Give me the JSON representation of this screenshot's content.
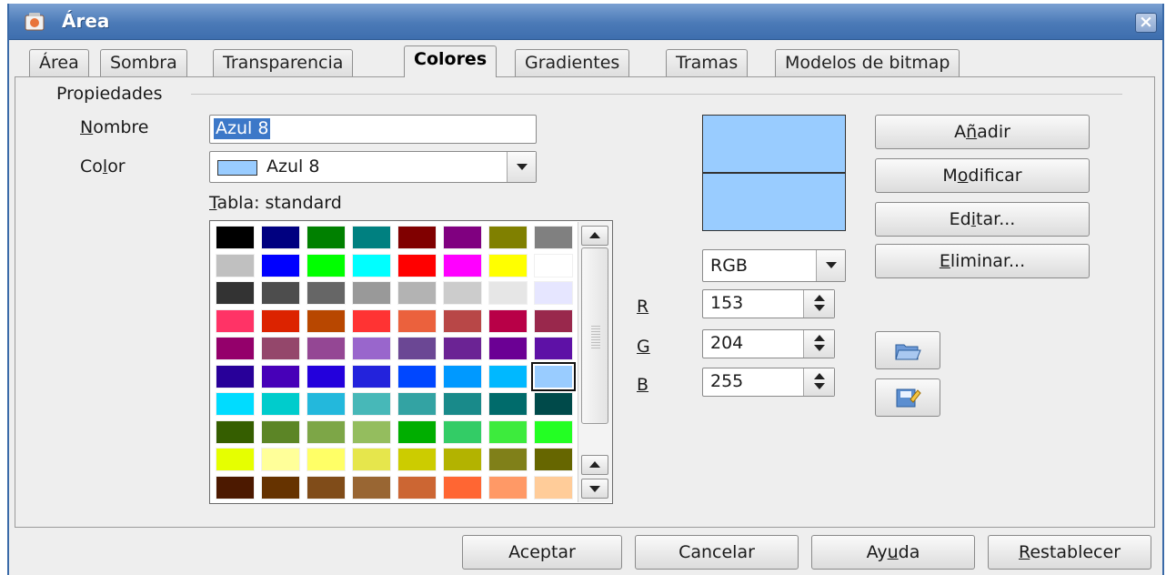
{
  "window": {
    "title": "Área"
  },
  "tabs": [
    {
      "label": "Área",
      "active": false
    },
    {
      "label": "Sombra",
      "active": false
    },
    {
      "label": "Transparencia",
      "active": false
    },
    {
      "label": "Colores",
      "active": true
    },
    {
      "label": "Gradientes",
      "active": false
    },
    {
      "label": "Tramas",
      "active": false
    },
    {
      "label": "Modelos de bitmap",
      "active": false
    }
  ],
  "properties": {
    "group_title": "Propiedades",
    "name_label_pre": "",
    "name_label_u": "N",
    "name_label_post": "ombre",
    "name_value": "Azul 8",
    "color_label_pre": "Co",
    "color_label_u": "l",
    "color_label_post": "or",
    "color_value": "Azul 8",
    "table_label_pre": "",
    "table_label_u": "T",
    "table_label_post": "abla: standard"
  },
  "palette": {
    "selected_color": "#99ccff",
    "rows": [
      [
        "#000000",
        "#000080",
        "#008000",
        "#008080",
        "#800000",
        "#800080",
        "#808000",
        "#808080"
      ],
      [
        "#c0c0c0",
        "#0000ff",
        "#00ff00",
        "#00ffff",
        "#ff0000",
        "#ff00ff",
        "#ffff00",
        "#ffffff"
      ],
      [
        "#333333",
        "#4d4d4d",
        "#666666",
        "#999999",
        "#b3b3b3",
        "#cccccc",
        "#e6e6e6",
        "#e6e6ff"
      ],
      [
        "#ff3366",
        "#dc2300",
        "#b84700",
        "#ff3333",
        "#eb613d",
        "#b84747",
        "#b80047",
        "#99284c"
      ],
      [
        "#94006b",
        "#94476b",
        "#944794",
        "#9966cc",
        "#6b4794",
        "#6b2394",
        "#6b0094",
        "#5e11a6"
      ],
      [
        "#280099",
        "#4700b8",
        "#2300dc",
        "#2323dc",
        "#0047ff",
        "#0099ff",
        "#00b8ff",
        "#99ccff"
      ],
      [
        "#00dcff",
        "#00cccc",
        "#23b8dc",
        "#47b8b8",
        "#33a3a3",
        "#198a8a",
        "#006b6b",
        "#004a4a"
      ],
      [
        "#355e00",
        "#5c8526",
        "#7da647",
        "#94bd5e",
        "#00ae00",
        "#33cc66",
        "#3deb3d",
        "#23ff23"
      ],
      [
        "#e6ff00",
        "#ffff99",
        "#ffff66",
        "#e6e64c",
        "#cccc00",
        "#b3b300",
        "#808019",
        "#666600"
      ],
      [
        "#4c1900",
        "#663300",
        "#804c19",
        "#996633",
        "#cc6633",
        "#ff6633",
        "#ff9966",
        "#ffcc99"
      ]
    ]
  },
  "color_model": {
    "value": "RGB"
  },
  "rgb": {
    "r_label": "R",
    "r_value": "153",
    "g_label": "G",
    "g_value": "204",
    "b_label": "B",
    "b_value": "255"
  },
  "side_buttons": {
    "add_pre": "A",
    "add_u": "ñ",
    "add_post": "adir",
    "modify_pre": "M",
    "modify_u": "o",
    "modify_post": "dificar",
    "edit_pre": "Ed",
    "edit_u": "i",
    "edit_post": "tar...",
    "delete_pre": "",
    "delete_u": "E",
    "delete_post": "liminar..."
  },
  "footer": {
    "ok": "Aceptar",
    "cancel": "Cancelar",
    "help_pre": "Ay",
    "help_u": "u",
    "help_post": "da",
    "reset_pre": "",
    "reset_u": "R",
    "reset_post": "establecer"
  },
  "icons": {
    "app": "area-dialog-icon",
    "close": "close-icon",
    "open": "open-folder-icon",
    "save": "save-edit-icon"
  }
}
